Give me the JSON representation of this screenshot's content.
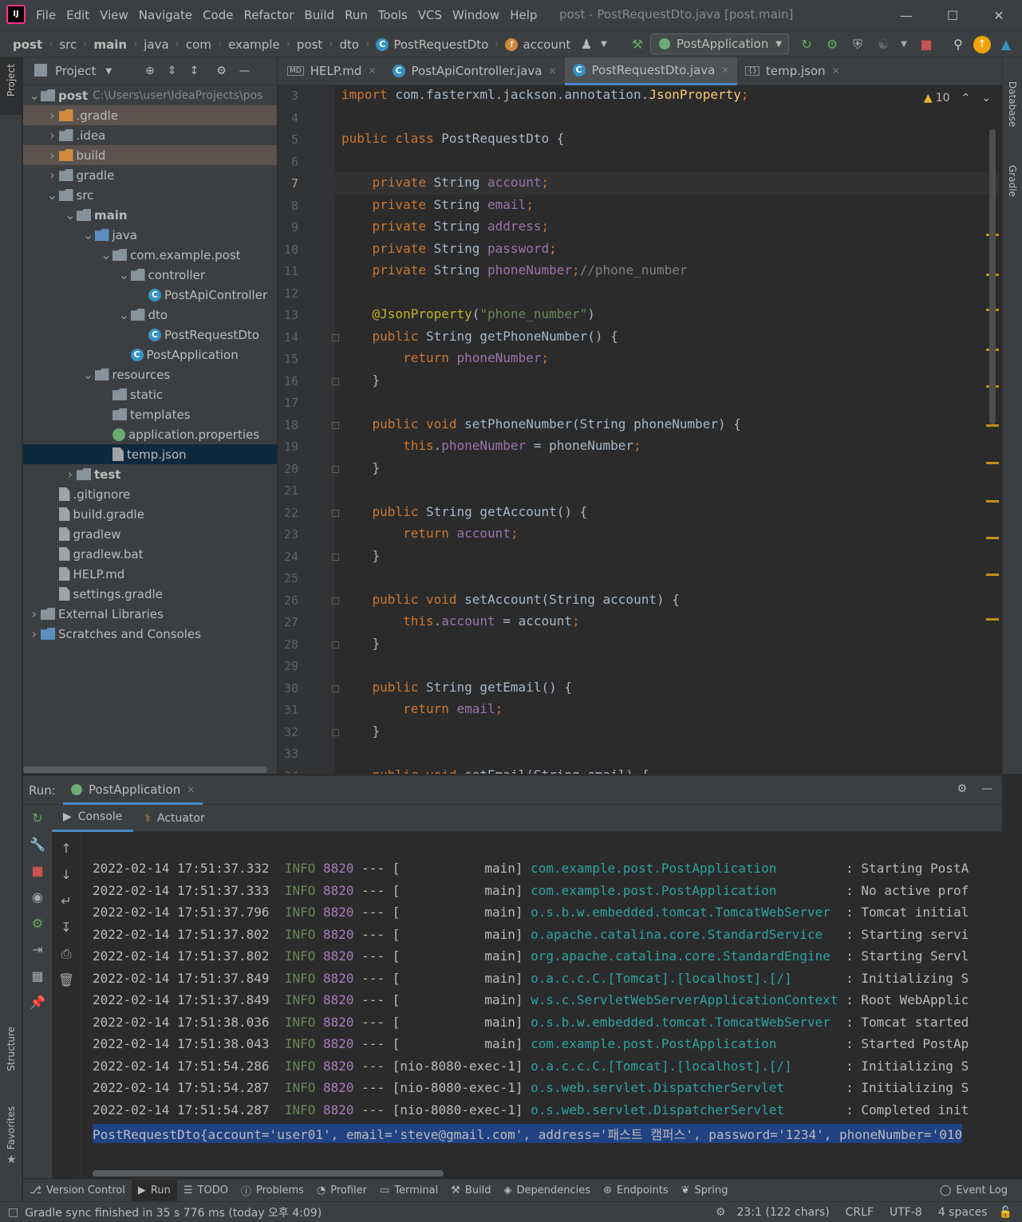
{
  "window": {
    "title": "post - PostRequestDto.java [post.main]",
    "logo_text": "IJ"
  },
  "menu": [
    "File",
    "Edit",
    "View",
    "Navigate",
    "Code",
    "Refactor",
    "Build",
    "Run",
    "Tools",
    "VCS",
    "Window",
    "Help"
  ],
  "breadcrumbs": [
    "post",
    "src",
    "main",
    "java",
    "com",
    "example",
    "post",
    "dto",
    "PostRequestDto",
    "account"
  ],
  "run_config": "PostApplication",
  "side_left": {
    "project": "Project",
    "structure": "Structure",
    "favorites": "Favorites"
  },
  "side_right": {
    "database": "Database",
    "gradle": "Gradle"
  },
  "project": {
    "title": "Project",
    "tree": [
      {
        "label": "post",
        "extra": "C:\\Users\\user\\IdeaProjects\\pos",
        "depth": 0,
        "arrow": "v",
        "icon": "folder-grey",
        "bold": true
      },
      {
        "label": ".gradle",
        "depth": 1,
        "arrow": ">",
        "icon": "folder-orange",
        "excluded": true
      },
      {
        "label": ".idea",
        "depth": 1,
        "arrow": ">",
        "icon": "folder-grey"
      },
      {
        "label": "build",
        "depth": 1,
        "arrow": ">",
        "icon": "folder-orange",
        "excluded": true
      },
      {
        "label": "gradle",
        "depth": 1,
        "arrow": ">",
        "icon": "folder-grey"
      },
      {
        "label": "src",
        "depth": 1,
        "arrow": "v",
        "icon": "folder-grey"
      },
      {
        "label": "main",
        "depth": 2,
        "arrow": "v",
        "icon": "folder-grey",
        "bold": true
      },
      {
        "label": "java",
        "depth": 3,
        "arrow": "v",
        "icon": "folder-blue"
      },
      {
        "label": "com.example.post",
        "depth": 4,
        "arrow": "v",
        "icon": "folder-grey"
      },
      {
        "label": "controller",
        "depth": 5,
        "arrow": "v",
        "icon": "folder-grey"
      },
      {
        "label": "PostApiController",
        "depth": 6,
        "arrow": "",
        "icon": "class"
      },
      {
        "label": "dto",
        "depth": 5,
        "arrow": "v",
        "icon": "folder-grey"
      },
      {
        "label": "PostRequestDto",
        "depth": 6,
        "arrow": "",
        "icon": "class"
      },
      {
        "label": "PostApplication",
        "depth": 5,
        "arrow": "",
        "icon": "class"
      },
      {
        "label": "resources",
        "depth": 3,
        "arrow": "v",
        "icon": "folder-grey"
      },
      {
        "label": "static",
        "depth": 4,
        "arrow": "",
        "icon": "folder-grey"
      },
      {
        "label": "templates",
        "depth": 4,
        "arrow": "",
        "icon": "folder-grey"
      },
      {
        "label": "application.properties",
        "depth": 4,
        "arrow": "",
        "icon": "spring"
      },
      {
        "label": "temp.json",
        "depth": 4,
        "arrow": "",
        "icon": "file",
        "selected": true
      },
      {
        "label": "test",
        "depth": 2,
        "arrow": ">",
        "icon": "folder-grey",
        "bold": true
      },
      {
        "label": ".gitignore",
        "depth": 1,
        "arrow": "",
        "icon": "file"
      },
      {
        "label": "build.gradle",
        "depth": 1,
        "arrow": "",
        "icon": "file"
      },
      {
        "label": "gradlew",
        "depth": 1,
        "arrow": "",
        "icon": "file"
      },
      {
        "label": "gradlew.bat",
        "depth": 1,
        "arrow": "",
        "icon": "file"
      },
      {
        "label": "HELP.md",
        "depth": 1,
        "arrow": "",
        "icon": "file"
      },
      {
        "label": "settings.gradle",
        "depth": 1,
        "arrow": "",
        "icon": "file"
      },
      {
        "label": "External Libraries",
        "depth": 0,
        "arrow": ">",
        "icon": "folder-grey"
      },
      {
        "label": "Scratches and Consoles",
        "depth": 0,
        "arrow": ">",
        "icon": "folder-blue"
      }
    ]
  },
  "editor_tabs": [
    {
      "label": "HELP.md",
      "icon": "MD"
    },
    {
      "label": "PostApiController.java",
      "icon": "C"
    },
    {
      "label": "PostRequestDto.java",
      "icon": "C",
      "active": true
    },
    {
      "label": "temp.json",
      "icon": "{}"
    }
  ],
  "editor": {
    "warnings": "10",
    "current_line": 7,
    "lines": [
      {
        "n": 3,
        "html": "<span class='kw'>import</span> com.fasterxml.jackson.annotation.<span class='fn'>JsonProperty</span><span class='kw'>;</span>"
      },
      {
        "n": 4,
        "html": ""
      },
      {
        "n": 5,
        "html": "<span class='kw'>public class</span> PostRequestDto {"
      },
      {
        "n": 6,
        "html": ""
      },
      {
        "n": 7,
        "html": "    <span class='kw'>private</span> String <span class='fld'>account</span><span class='kw'>;</span>"
      },
      {
        "n": 8,
        "html": "    <span class='kw'>private</span> String <span class='fld'>email</span><span class='kw'>;</span>"
      },
      {
        "n": 9,
        "html": "    <span class='kw'>private</span> String <span class='fld'>address</span><span class='kw'>;</span>"
      },
      {
        "n": 10,
        "html": "    <span class='kw'>private</span> String <span class='fld'>password</span><span class='kw'>;</span>"
      },
      {
        "n": 11,
        "html": "    <span class='kw'>private</span> String <span class='fld'>phoneNumber</span><span class='kw'>;</span><span class='cm'>//phone_number</span>"
      },
      {
        "n": 12,
        "html": ""
      },
      {
        "n": 13,
        "html": "    <span class='ann'>@JsonProperty</span>(<span class='str'>\"phone_number\"</span>)"
      },
      {
        "n": 14,
        "html": "    <span class='kw'>public</span> String <span class='mth'>getPhoneNumber</span>() {"
      },
      {
        "n": 15,
        "html": "        <span class='kw'>return</span> <span class='fld'>phoneNumber</span><span class='kw'>;</span>"
      },
      {
        "n": 16,
        "html": "    }"
      },
      {
        "n": 17,
        "html": ""
      },
      {
        "n": 18,
        "html": "    <span class='kw'>public void</span> <span class='mth'>setPhoneNumber</span>(String phoneNumber) {"
      },
      {
        "n": 19,
        "html": "        <span class='kw'>this</span>.<span class='fld'>phoneNumber</span> = phoneNumber<span class='kw'>;</span>"
      },
      {
        "n": 20,
        "html": "    }"
      },
      {
        "n": 21,
        "html": ""
      },
      {
        "n": 22,
        "html": "    <span class='kw'>public</span> String <span class='mth'>getAccount</span>() {"
      },
      {
        "n": 23,
        "html": "        <span class='kw'>return</span> <span class='fld'>account</span><span class='kw'>;</span>"
      },
      {
        "n": 24,
        "html": "    }"
      },
      {
        "n": 25,
        "html": ""
      },
      {
        "n": 26,
        "html": "    <span class='kw'>public void</span> <span class='mth'>setAccount</span>(String account) {"
      },
      {
        "n": 27,
        "html": "        <span class='kw'>this</span>.<span class='fld'>account</span> = account<span class='kw'>;</span>"
      },
      {
        "n": 28,
        "html": "    }"
      },
      {
        "n": 29,
        "html": ""
      },
      {
        "n": 30,
        "html": "    <span class='kw'>public</span> String <span class='mth'>getEmail</span>() {"
      },
      {
        "n": 31,
        "html": "        <span class='kw'>return</span> <span class='fld'>email</span><span class='kw'>;</span>"
      },
      {
        "n": 32,
        "html": "    }"
      },
      {
        "n": 33,
        "html": ""
      },
      {
        "n": 34,
        "html": "    <span class='kw'>public void</span> <span class='mth'>setEmail</span>(String email) {"
      }
    ]
  },
  "run": {
    "label": "Run:",
    "tab": "PostApplication",
    "subtabs": [
      "Console",
      "Actuator"
    ],
    "log": [
      {
        "ts": "2022-02-14 17:51:37.332",
        "lvl": "INFO",
        "pid": "8820",
        "sep": "---",
        "thread": "[           main]",
        "logger": "com.example.post.PostApplication        ",
        "msg": ": Starting PostA"
      },
      {
        "ts": "2022-02-14 17:51:37.333",
        "lvl": "INFO",
        "pid": "8820",
        "sep": "---",
        "thread": "[           main]",
        "logger": "com.example.post.PostApplication        ",
        "msg": ": No active prof"
      },
      {
        "ts": "2022-02-14 17:51:37.796",
        "lvl": "INFO",
        "pid": "8820",
        "sep": "---",
        "thread": "[           main]",
        "logger": "o.s.b.w.embedded.tomcat.TomcatWebServer ",
        "msg": ": Tomcat initial"
      },
      {
        "ts": "2022-02-14 17:51:37.802",
        "lvl": "INFO",
        "pid": "8820",
        "sep": "---",
        "thread": "[           main]",
        "logger": "o.apache.catalina.core.StandardService  ",
        "msg": ": Starting servi"
      },
      {
        "ts": "2022-02-14 17:51:37.802",
        "lvl": "INFO",
        "pid": "8820",
        "sep": "---",
        "thread": "[           main]",
        "logger": "org.apache.catalina.core.StandardEngine ",
        "msg": ": Starting Servl"
      },
      {
        "ts": "2022-02-14 17:51:37.849",
        "lvl": "INFO",
        "pid": "8820",
        "sep": "---",
        "thread": "[           main]",
        "logger": "o.a.c.c.C.[Tomcat].[localhost].[/]      ",
        "msg": ": Initializing S"
      },
      {
        "ts": "2022-02-14 17:51:37.849",
        "lvl": "INFO",
        "pid": "8820",
        "sep": "---",
        "thread": "[           main]",
        "logger": "w.s.c.ServletWebServerApplicationContext",
        "msg": ": Root WebApplic"
      },
      {
        "ts": "2022-02-14 17:51:38.036",
        "lvl": "INFO",
        "pid": "8820",
        "sep": "---",
        "thread": "[           main]",
        "logger": "o.s.b.w.embedded.tomcat.TomcatWebServer ",
        "msg": ": Tomcat started"
      },
      {
        "ts": "2022-02-14 17:51:38.043",
        "lvl": "INFO",
        "pid": "8820",
        "sep": "---",
        "thread": "[           main]",
        "logger": "com.example.post.PostApplication        ",
        "msg": ": Started PostAp"
      },
      {
        "ts": "2022-02-14 17:51:54.286",
        "lvl": "INFO",
        "pid": "8820",
        "sep": "---",
        "thread": "[nio-8080-exec-1]",
        "logger": "o.a.c.c.C.[Tomcat].[localhost].[/]      ",
        "msg": ": Initializing S"
      },
      {
        "ts": "2022-02-14 17:51:54.287",
        "lvl": "INFO",
        "pid": "8820",
        "sep": "---",
        "thread": "[nio-8080-exec-1]",
        "logger": "o.s.web.servlet.DispatcherServlet       ",
        "msg": ": Initializing S"
      },
      {
        "ts": "2022-02-14 17:51:54.287",
        "lvl": "INFO",
        "pid": "8820",
        "sep": "---",
        "thread": "[nio-8080-exec-1]",
        "logger": "o.s.web.servlet.DispatcherServlet       ",
        "msg": ": Completed init"
      }
    ],
    "output": "PostRequestDto{account='user01', email='steve@gmail.com', address='패스트 캠퍼스', password='1234', phoneNumber='010"
  },
  "bottom_tabs": [
    "Version Control",
    "Run",
    "TODO",
    "Problems",
    "Profiler",
    "Terminal",
    "Build",
    "Dependencies",
    "Endpoints",
    "Spring"
  ],
  "event_log": "Event Log",
  "status": {
    "message": "Gradle sync finished in 35 s 776 ms (today 오후 4:09)",
    "position": "23:1 (122 chars)",
    "line_sep": "CRLF",
    "encoding": "UTF-8",
    "indent": "4 spaces"
  },
  "colors": {
    "accent": "#4a88c7",
    "bg": "#2b2b2b",
    "panel": "#3c3f41"
  }
}
